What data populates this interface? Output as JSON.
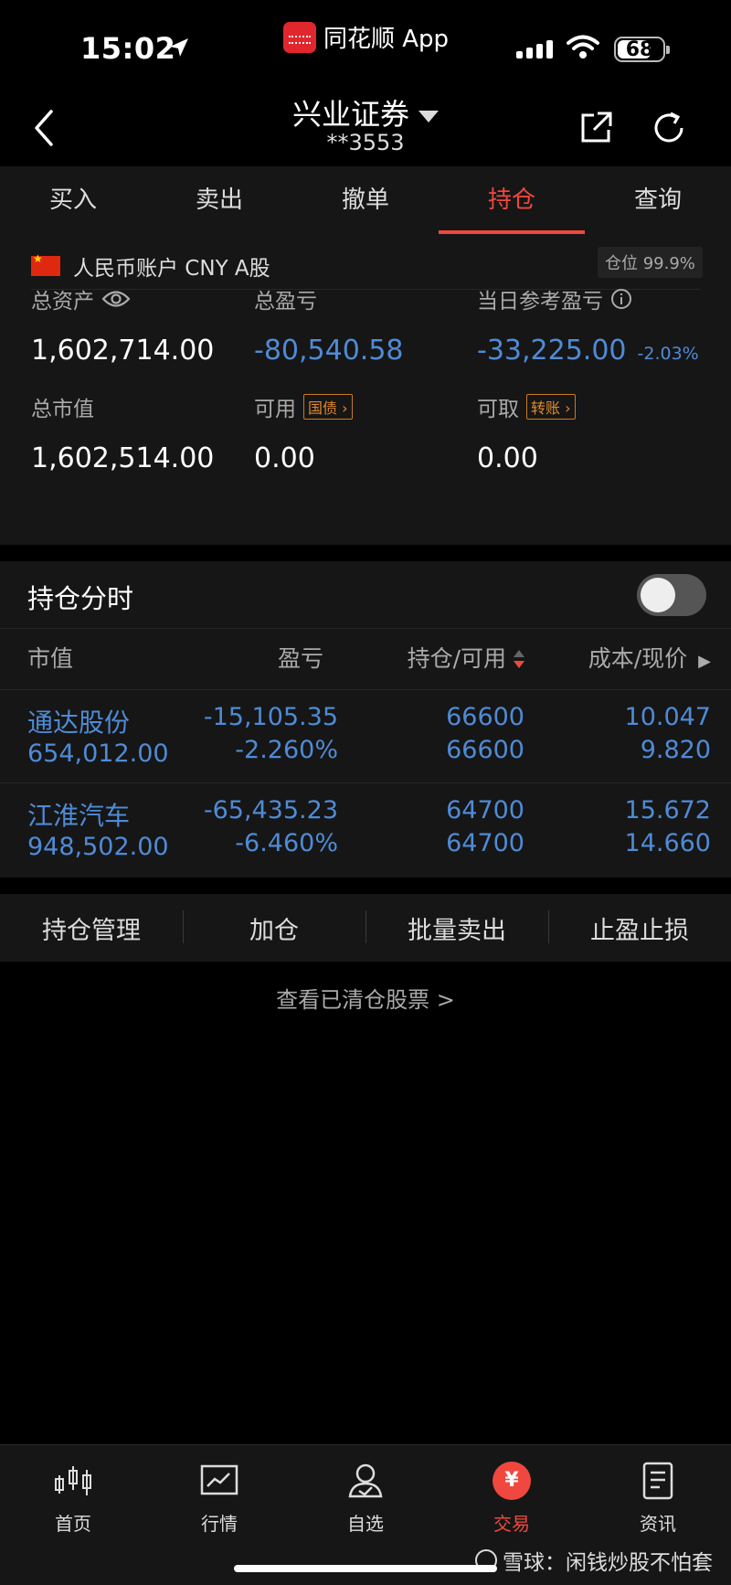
{
  "status_bar": {
    "time": "15:02",
    "app_name": "同花顺 App",
    "battery": "68"
  },
  "header": {
    "title": "兴业证券",
    "account_no": "**3553"
  },
  "tabs": [
    {
      "label": "买入",
      "active": false
    },
    {
      "label": "卖出",
      "active": false
    },
    {
      "label": "撤单",
      "active": false
    },
    {
      "label": "持仓",
      "active": true
    },
    {
      "label": "查询",
      "active": false
    }
  ],
  "account": {
    "currency_label": "人民币账户 CNY A股",
    "position_ratio": "仓位 99.9%",
    "total_assets_label": "总资产",
    "total_assets": "1,602,714.00",
    "total_pl_label": "总盈亏",
    "total_pl": "-80,540.58",
    "day_pl_label": "当日参考盈亏",
    "day_pl": "-33,225.00",
    "day_pl_pct": "-2.03%",
    "market_value_label": "总市值",
    "market_value": "1,602,514.00",
    "available_label": "可用",
    "available_tag": "国债",
    "available": "0.00",
    "withdrawable_label": "可取",
    "withdrawable_tag": "转账",
    "withdrawable": "0.00"
  },
  "positions": {
    "section_title": "持仓分时",
    "toggle_on": false,
    "headers": {
      "market_value": "市值",
      "pl": "盈亏",
      "qty": "持仓/可用",
      "cost": "成本/现价"
    },
    "rows": [
      {
        "name": "通达股份",
        "market_value": "654,012.00",
        "pl": "-15,105.35",
        "pl_pct": "-2.260%",
        "holding": "66600",
        "available": "66600",
        "cost": "10.047",
        "price": "9.820"
      },
      {
        "name": "江淮汽车",
        "market_value": "948,502.00",
        "pl": "-65,435.23",
        "pl_pct": "-6.460%",
        "holding": "64700",
        "available": "64700",
        "cost": "15.672",
        "price": "14.660"
      }
    ]
  },
  "actions": [
    "持仓管理",
    "加仓",
    "批量卖出",
    "止盈止损"
  ],
  "cleared_link": "查看已清仓股票 >",
  "bottom_tabs": [
    {
      "label": "首页",
      "icon": "candlestick-icon"
    },
    {
      "label": "行情",
      "icon": "chart-icon"
    },
    {
      "label": "自选",
      "icon": "user-icon"
    },
    {
      "label": "交易",
      "icon": "yen-icon",
      "active": true
    },
    {
      "label": "资讯",
      "icon": "document-icon"
    }
  ],
  "watermark": "雪球：闲钱炒股不怕套",
  "colors": {
    "accent": "#f0473f",
    "loss": "#4f8bd6",
    "panel": "#161616",
    "tag": "#e08a2e"
  }
}
